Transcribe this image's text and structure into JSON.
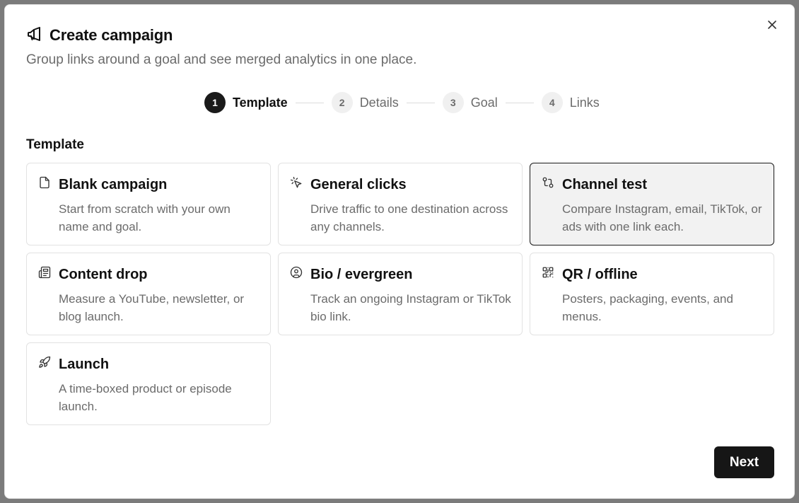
{
  "dialog": {
    "title": "Create campaign",
    "subtitle": "Group links around a goal and see merged analytics in one place.",
    "title_icon": "megaphone-icon",
    "close_icon": "close-icon"
  },
  "stepper": {
    "steps": [
      {
        "number": "1",
        "label": "Template",
        "active": true
      },
      {
        "number": "2",
        "label": "Details",
        "active": false
      },
      {
        "number": "3",
        "label": "Goal",
        "active": false
      },
      {
        "number": "4",
        "label": "Links",
        "active": false
      }
    ]
  },
  "section": {
    "label": "Template"
  },
  "templates": [
    {
      "title": "Blank campaign",
      "description": "Start from scratch with your own name and goal.",
      "icon": "file-icon",
      "selected": false
    },
    {
      "title": "General clicks",
      "description": "Drive traffic to one destination across any channels.",
      "icon": "pointer-click-icon",
      "selected": false
    },
    {
      "title": "Channel test",
      "description": "Compare Instagram, email, TikTok, or ads with one link each.",
      "icon": "git-compare-icon",
      "selected": true
    },
    {
      "title": "Content drop",
      "description": "Measure a YouTube, newsletter, or blog launch.",
      "icon": "newspaper-icon",
      "selected": false
    },
    {
      "title": "Bio / evergreen",
      "description": "Track an ongoing Instagram or TikTok bio link.",
      "icon": "user-circle-icon",
      "selected": false
    },
    {
      "title": "QR / offline",
      "description": "Posters, packaging, events, and menus.",
      "icon": "qr-code-icon",
      "selected": false
    },
    {
      "title": "Launch",
      "description": "A time-boxed product or episode launch.",
      "icon": "rocket-icon",
      "selected": false
    }
  ],
  "footer": {
    "next_label": "Next"
  },
  "colors": {
    "accent": "#161616",
    "selected_bg": "#f2f2f2",
    "muted_text": "#6b6b6b",
    "backdrop": "#7b7b7b"
  }
}
